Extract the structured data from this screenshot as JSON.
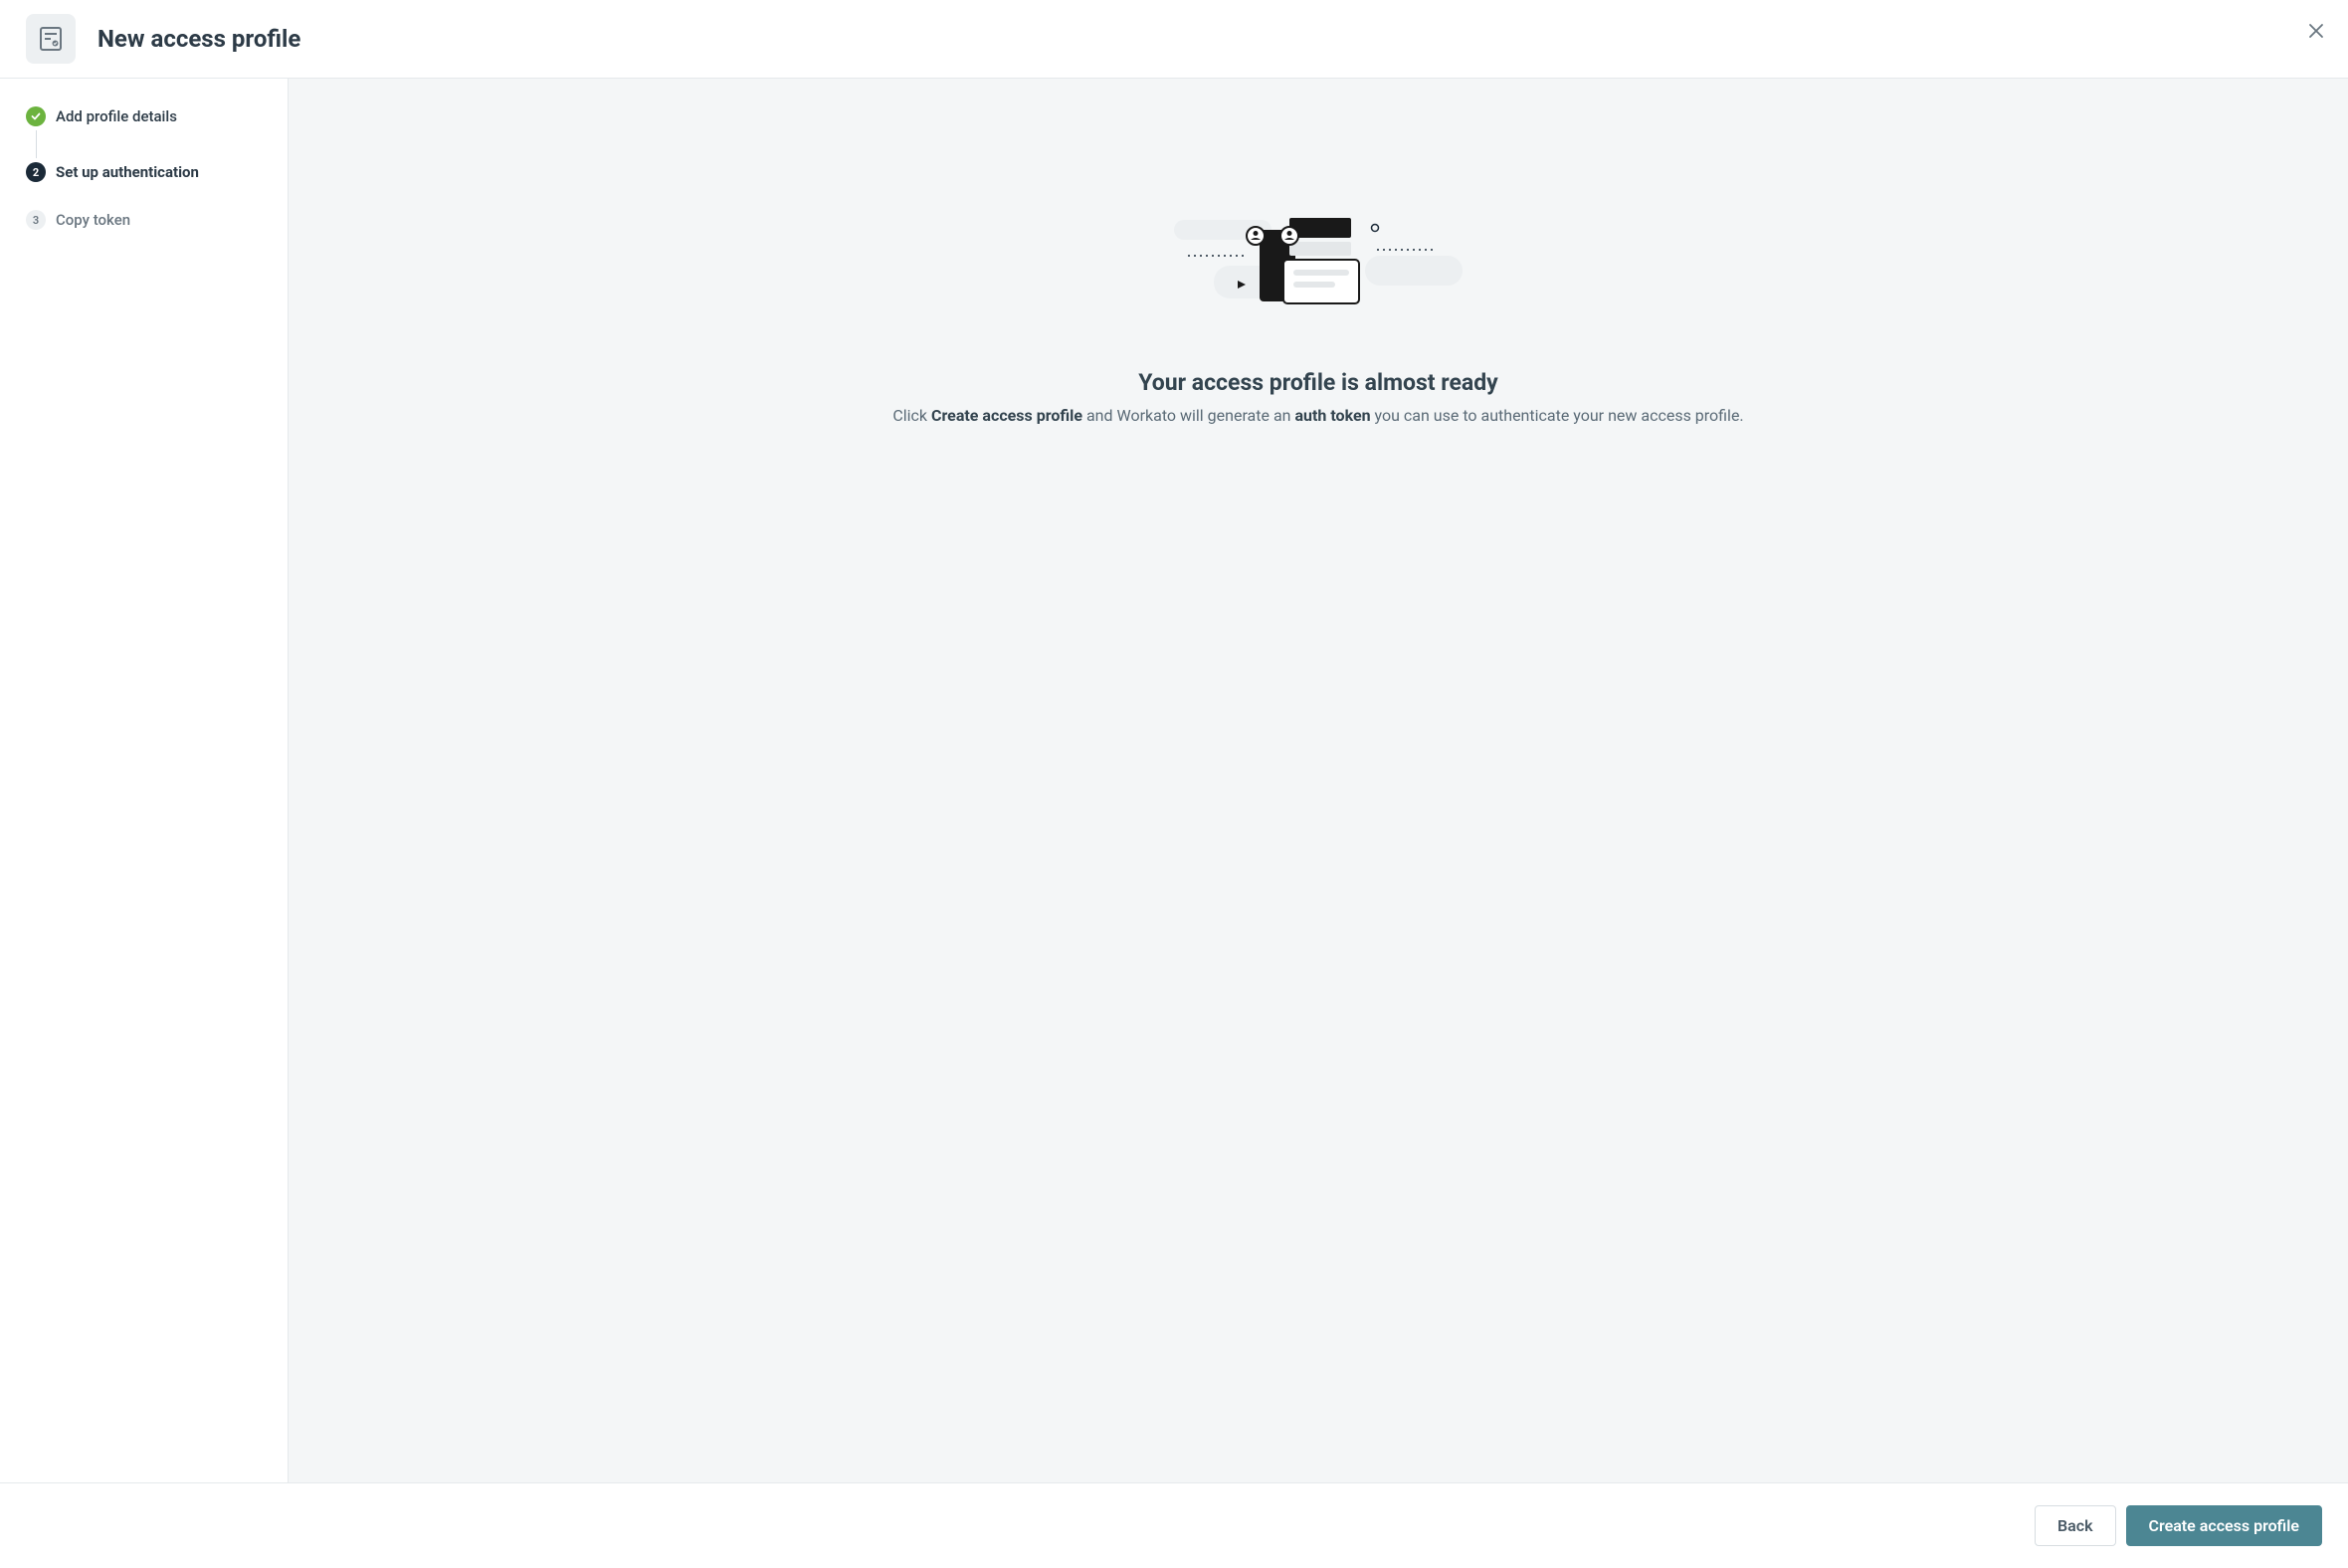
{
  "header": {
    "title": "New access profile"
  },
  "steps": [
    {
      "label": "Add profile details"
    },
    {
      "label": "Set up authentication"
    },
    {
      "label": "Copy token",
      "number": "3"
    }
  ],
  "main": {
    "heading": "Your access profile is almost ready",
    "desc_prefix": "Click ",
    "desc_strong1": "Create access profile",
    "desc_mid": " and Workato will generate an ",
    "desc_strong2": "auth token",
    "desc_suffix": " you can use to authenticate your new access profile."
  },
  "footer": {
    "back_label": "Back",
    "create_label": "Create access profile"
  }
}
